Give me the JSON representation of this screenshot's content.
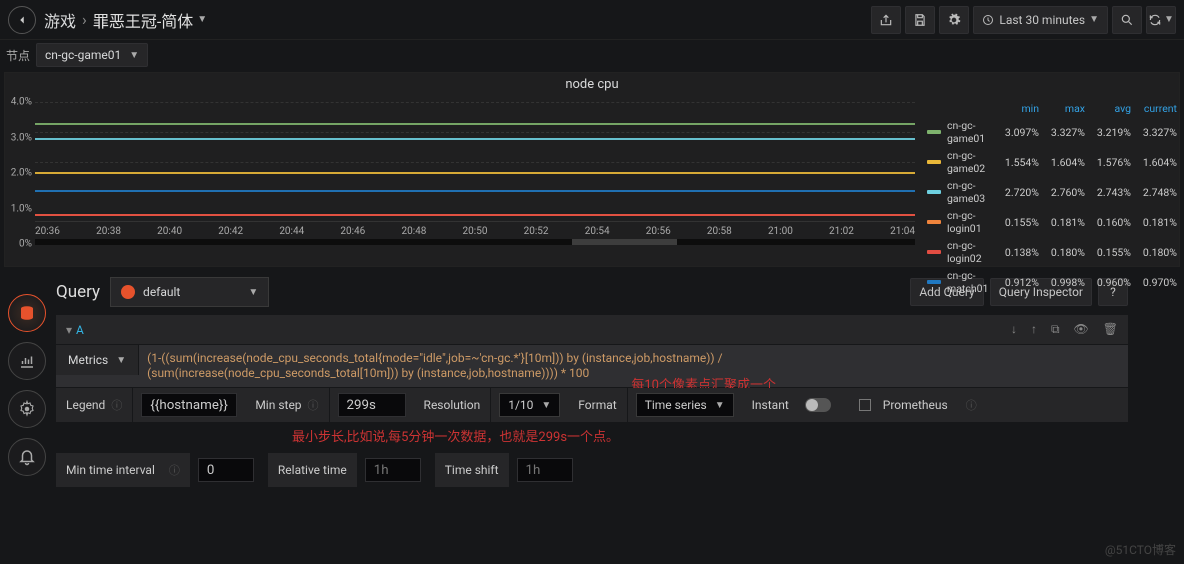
{
  "breadcrumb": {
    "root": "游戏",
    "title": "罪恶王冠-简体"
  },
  "timepicker": "Last 30 minutes",
  "node_label": "节点",
  "node_value": "cn-gc-game01",
  "panel_title": "node cpu",
  "chart_data": {
    "type": "line",
    "title": "node cpu",
    "ylabel": "",
    "xlabel": "",
    "ylim": [
      0,
      4.0
    ],
    "y_ticks": [
      "4.0%",
      "3.0%",
      "2.0%",
      "1.0%",
      "0%"
    ],
    "x_ticks": [
      "20:36",
      "20:38",
      "20:40",
      "20:42",
      "20:44",
      "20:46",
      "20:48",
      "20:50",
      "20:52",
      "20:54",
      "20:56",
      "20:58",
      "21:00",
      "21:02",
      "21:04"
    ],
    "series": [
      {
        "name": "cn-gc-game01",
        "color": "#7eb26d",
        "approx": 3.22
      },
      {
        "name": "cn-gc-game02",
        "color": "#eab839",
        "approx": 1.58
      },
      {
        "name": "cn-gc-game03",
        "color": "#6ed0e0",
        "approx": 2.74
      },
      {
        "name": "cn-gc-login01",
        "color": "#ef843c",
        "approx": 0.17
      },
      {
        "name": "cn-gc-login02",
        "color": "#e24d42",
        "approx": 0.16
      },
      {
        "name": "cn-gc-match01",
        "color": "#1f78c1",
        "approx": 0.96
      }
    ]
  },
  "legend": {
    "headers": [
      "min",
      "max",
      "avg",
      "current"
    ],
    "rows": [
      {
        "name": "cn-gc-game01",
        "color": "#7eb26d",
        "vals": [
          "3.097%",
          "3.327%",
          "3.219%",
          "3.327%"
        ]
      },
      {
        "name": "cn-gc-game02",
        "color": "#eab839",
        "vals": [
          "1.554%",
          "1.604%",
          "1.576%",
          "1.604%"
        ]
      },
      {
        "name": "cn-gc-game03",
        "color": "#6ed0e0",
        "vals": [
          "2.720%",
          "2.760%",
          "2.743%",
          "2.748%"
        ]
      },
      {
        "name": "cn-gc-login01",
        "color": "#ef843c",
        "vals": [
          "0.155%",
          "0.181%",
          "0.160%",
          "0.181%"
        ]
      },
      {
        "name": "cn-gc-login02",
        "color": "#e24d42",
        "vals": [
          "0.138%",
          "0.180%",
          "0.155%",
          "0.180%"
        ]
      },
      {
        "name": "cn-gc-match01",
        "color": "#1f78c1",
        "vals": [
          "0.912%",
          "0.998%",
          "0.960%",
          "0.970%"
        ]
      }
    ]
  },
  "query": {
    "title": "Query",
    "datasource": "default",
    "add_query": "Add Query",
    "inspector": "Query Inspector",
    "help": "?",
    "row_label": "A",
    "metrics_label": "Metrics",
    "expr": "(1-((sum(increase(node_cpu_seconds_total{mode=\"idle\",job=~'cn-gc.*'}[10m])) by (instance,job,hostname)) / (sum(increase(node_cpu_seconds_total[10m])) by (instance,job,hostname)))) * 100",
    "annotation1": "每10个像素点汇聚成一个",
    "legend_label": "Legend",
    "legend_value": "{{hostname}}",
    "minstep_label": "Min step",
    "minstep_value": "299s",
    "annotation2": "最小步长,比如说,每5分钟一次数据，也就是299s一个点。",
    "resolution_label": "Resolution",
    "resolution_value": "1/10",
    "format_label": "Format",
    "format_value": "Time series",
    "instant_label": "Instant",
    "prometheus_label": "Prometheus",
    "min_time_interval_label": "Min time interval",
    "min_time_interval_value": "0",
    "relative_time_label": "Relative time",
    "relative_time_placeholder": "1h",
    "time_shift_label": "Time shift",
    "time_shift_placeholder": "1h"
  },
  "watermark": "@51CTO博客"
}
